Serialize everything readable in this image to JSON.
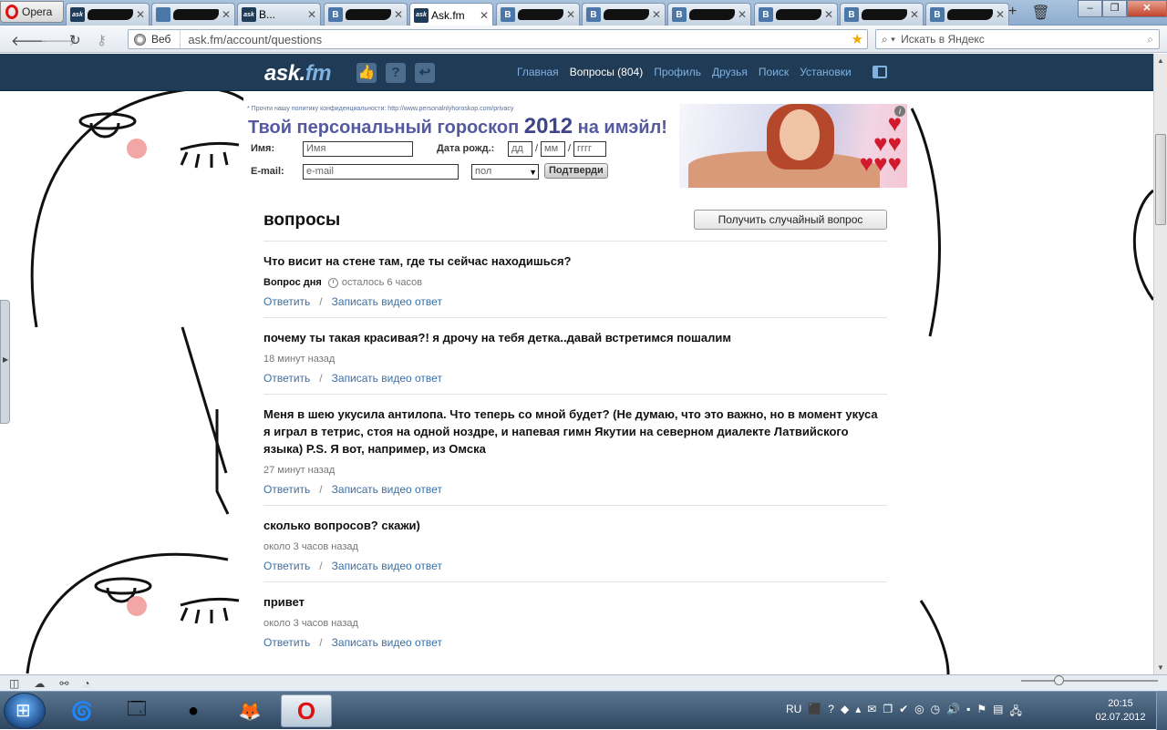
{
  "browser": {
    "menu_label": "Opera",
    "tabs": [
      {
        "title": "",
        "icon": "ask-favicon",
        "redacted": true
      },
      {
        "title": "",
        "icon": "generic-favicon",
        "redacted": true
      },
      {
        "title": "В...",
        "icon": "ask-favicon",
        "redacted": true
      },
      {
        "title": "",
        "icon": "vk-favicon",
        "redacted": true
      },
      {
        "title": "Ask.fm",
        "icon": "ask-favicon",
        "active": true
      },
      {
        "title": "",
        "icon": "vk-favicon",
        "redacted": true
      },
      {
        "title": "",
        "icon": "vk-favicon",
        "redacted": true
      },
      {
        "title": "",
        "icon": "vk-favicon",
        "redacted": true
      },
      {
        "title": "",
        "icon": "vk-favicon",
        "redacted": true
      },
      {
        "title": "",
        "icon": "vk-favicon",
        "redacted": true
      },
      {
        "title": "",
        "icon": "vk-favicon",
        "redacted": true
      }
    ],
    "address": {
      "web_label": "Веб",
      "url": "ask.fm/account/questions"
    },
    "search": {
      "placeholder": "Искать в Яндекс"
    }
  },
  "site": {
    "logo_main": "ask",
    "logo_dot": ".",
    "logo_suffix": "fm",
    "nav": {
      "home": "Главная",
      "questions": "Вопросы (804)",
      "profile": "Профиль",
      "friends": "Друзья",
      "search": "Поиск",
      "settings": "Установки"
    }
  },
  "banner": {
    "privacy": "* Прочти нашу политику конфиденциальности: http://www.personalnlyhoroskop.com/privacy",
    "headline_a": "Твой персональный гороскоп ",
    "headline_year": "2012",
    "headline_b": " на имэйл!",
    "name_label": "Имя:",
    "name_placeholder": "Имя",
    "birth_label": "Дата рожд.:",
    "day_placeholder": "дд",
    "month_placeholder": "мм",
    "year_placeholder": "гггг",
    "date_sep": "/",
    "email_label": "E-mail:",
    "email_placeholder": "e-mail",
    "gender_value": "пол",
    "submit": "Подтверди",
    "info": "i"
  },
  "page": {
    "title": "вопросы",
    "random_button": "Получить случайный вопрос"
  },
  "questions": [
    {
      "text": "Что висит на стене там, где ты сейчас находишься?",
      "badge": "Вопрос дня",
      "time": "осталось 6 часов",
      "reply": "Ответить",
      "video": "Записать видео ответ"
    },
    {
      "text": "почему ты такая красивая?! я дрочу на тебя детка..давай встретимся пошалим",
      "time": "18 минут назад",
      "reply": "Ответить",
      "video": "Записать видео ответ"
    },
    {
      "text": "Меня в шею укусила антилопа. Что теперь со мной будет? (Не думаю, что это важно, но в момент укуса я играл в тетрис, стоя на одной ноздре, и напевая гимн Якутии на северном диалекте Латвийского языка) P.S. Я вот, например, из Омска",
      "time": "27 минут назад",
      "reply": "Ответить",
      "video": "Записать видео ответ"
    },
    {
      "text": "сколько вопросов? скажи)",
      "time": "около 3 часов назад",
      "reply": "Ответить",
      "video": "Записать видео ответ"
    },
    {
      "text": "привет",
      "time": "около 3 часов назад",
      "reply": "Ответить",
      "video": "Записать видео ответ"
    }
  ],
  "action_sep": "/",
  "taskbar": {
    "lang": "RU",
    "time": "20:15",
    "date": "02.07.2012"
  }
}
